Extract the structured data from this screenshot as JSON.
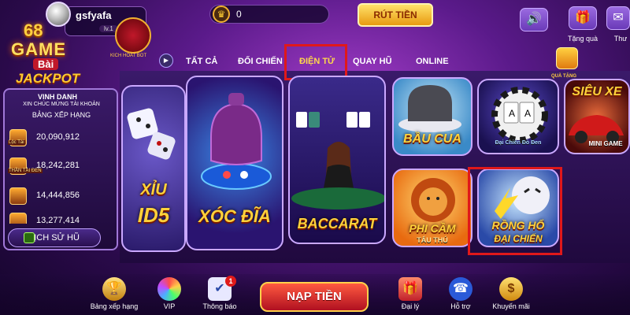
{
  "header": {
    "username": "gsfyafa",
    "level": "lv.1",
    "shield_label": "KICH HOAT BOT",
    "coin_balance": "0",
    "withdraw_label": "RÚT TIỀN",
    "gift_label": "Tặng quà",
    "message_label": "Thư"
  },
  "logo": {
    "number": "68",
    "game": "GAME",
    "bai": "Bài",
    "jackpot": "JACKPOT"
  },
  "leaderboard": {
    "title": "VINH DANH",
    "subtitle": "XIN CHÚC MỪNG TÀI KHOẢN",
    "subtitle2": "BẢNG XẾP HẠNG",
    "rows": [
      {
        "game": "Lộc Tài",
        "amount": "20,090,912"
      },
      {
        "game": "THẦN TÀI ĐEN",
        "amount": "18,242,281"
      },
      {
        "game": "",
        "amount": "14,444,856"
      },
      {
        "game": "",
        "amount": "13,277,414"
      }
    ],
    "history_label": "LỊCH SỬ HŨ"
  },
  "tabs": [
    {
      "label": "TẤT CẢ",
      "active": false
    },
    {
      "label": "ĐỐI CHIẾN",
      "active": false
    },
    {
      "label": "ĐIỆN TỬ",
      "active": true
    },
    {
      "label": "QUAY HŨ",
      "active": false
    },
    {
      "label": "ONLINE",
      "active": false
    }
  ],
  "games": {
    "tai_xiu": {
      "title1": "XỈU",
      "title2": "ID5"
    },
    "xoc_dia": {
      "title": "XÓC ĐĨA"
    },
    "baccarat": {
      "title": "BACCARAT"
    },
    "bau_cua": {
      "title": "BẦU CUA"
    },
    "poker": {
      "sub": "Đại Chiến Đỏ Đen"
    },
    "sieu_xe": {
      "title": "SIÊU XE",
      "sub": "MINI GAME"
    },
    "phi_cam": {
      "title": "PHI CẦM",
      "sub": "TẨU THÚ"
    },
    "rong_ho": {
      "title1": "RỒNG HỔ",
      "title2": "ĐẠI CHIẾN"
    },
    "qua_tang": {
      "label": "QUÀ TẶNG"
    }
  },
  "bottom_nav": {
    "items": [
      {
        "label": "Bảng xếp hạng"
      },
      {
        "label": "VIP"
      },
      {
        "label": "Thông báo"
      },
      {
        "label": "Đại lý"
      },
      {
        "label": "Hỗ trợ"
      },
      {
        "label": "Khuyến mãi"
      }
    ],
    "notification_count": "1",
    "recharge_label": "NẠP TIỀN"
  },
  "colors": {
    "accent_gold": "#ffd23a",
    "highlight_red": "#e0181a",
    "panel_purple": "#3a1a6a"
  }
}
